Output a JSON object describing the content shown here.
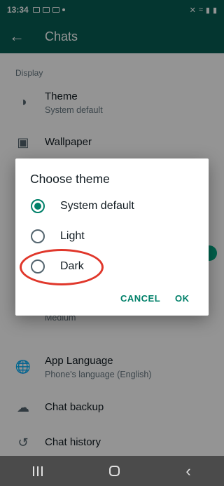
{
  "status_bar": {
    "time": "13:34"
  },
  "header": {
    "title": "Chats"
  },
  "settings": {
    "display_section": "Display",
    "theme": {
      "title": "Theme",
      "value": "System default"
    },
    "wallpaper": {
      "title": "Wallpaper"
    },
    "font_size": {
      "value": "Medium"
    },
    "app_language": {
      "title": "App Language",
      "value": "Phone's language (English)"
    },
    "chat_backup": {
      "title": "Chat backup"
    },
    "chat_history": {
      "title": "Chat history"
    }
  },
  "dialog": {
    "title": "Choose theme",
    "options": [
      {
        "label": "System default",
        "selected": true
      },
      {
        "label": "Light",
        "selected": false
      },
      {
        "label": "Dark",
        "selected": false
      }
    ],
    "cancel_label": "CANCEL",
    "ok_label": "OK"
  },
  "colors": {
    "brand": "#075e54",
    "accent": "#008069",
    "annotation": "#e0372b"
  }
}
